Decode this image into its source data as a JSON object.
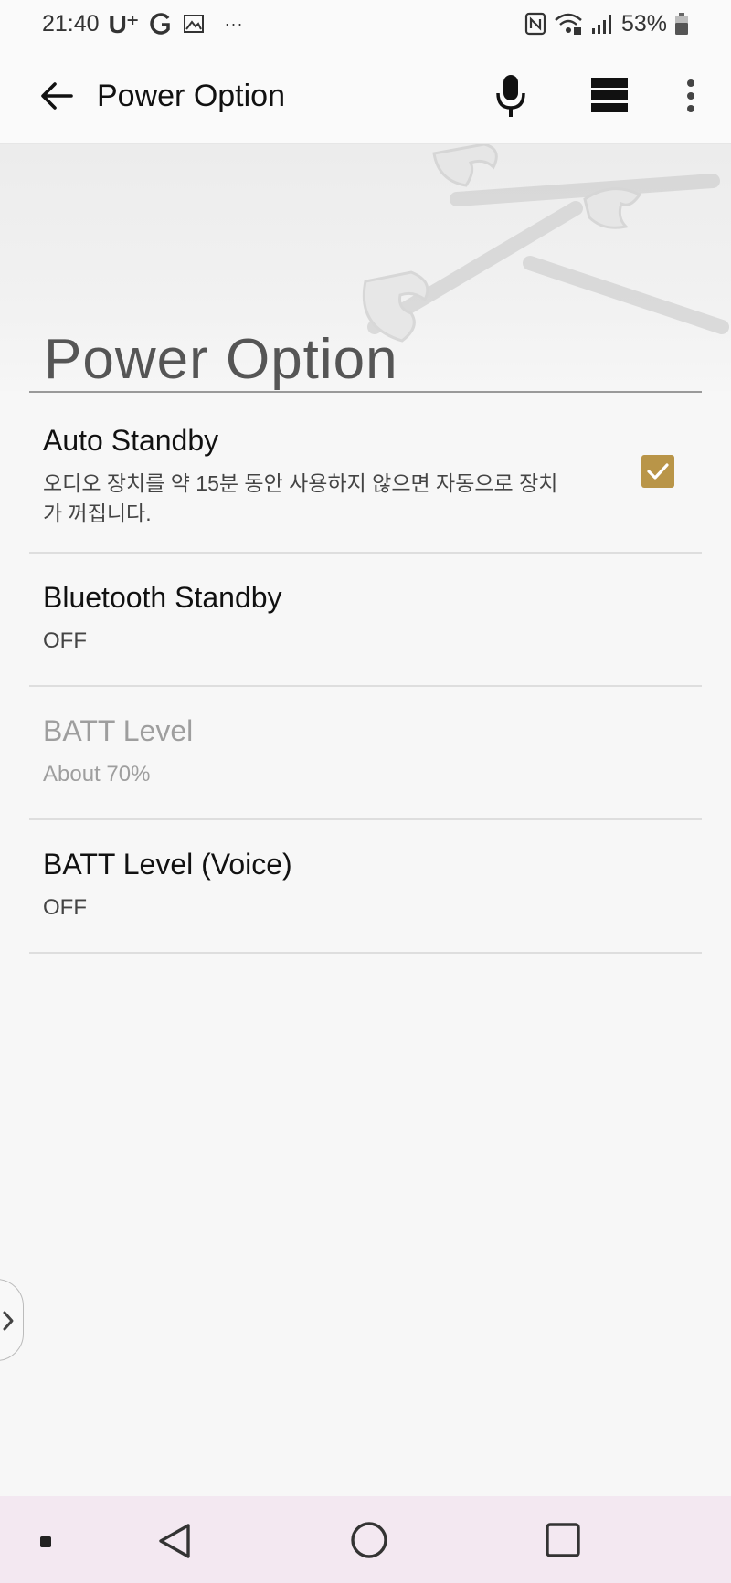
{
  "status_bar": {
    "time": "21:40",
    "carrier": "U⁺",
    "more_indicator": "···",
    "battery": "53%"
  },
  "app_bar": {
    "title": "Power Option",
    "icons": [
      "back-arrow-icon",
      "mic-icon",
      "view-toggle-icon",
      "more-vert-icon"
    ]
  },
  "page": {
    "section_title": "Power Option"
  },
  "settings": [
    {
      "title": "Auto Standby",
      "subtitle": "오디오 장치를 약 15분 동안 사용하지 않으면 자동으로 장치가 꺼집니다.",
      "checked": true,
      "enabled": true
    },
    {
      "title": "Bluetooth Standby",
      "subtitle": "OFF",
      "enabled": true
    },
    {
      "title": "BATT Level",
      "subtitle": "About 70%",
      "enabled": false
    },
    {
      "title": "BATT Level (Voice)",
      "subtitle": "OFF",
      "enabled": true
    }
  ],
  "colors": {
    "accent": "#b99548",
    "nav_bar_bg": "#f3e8f1",
    "disabled_text": "#9e9e9e"
  }
}
